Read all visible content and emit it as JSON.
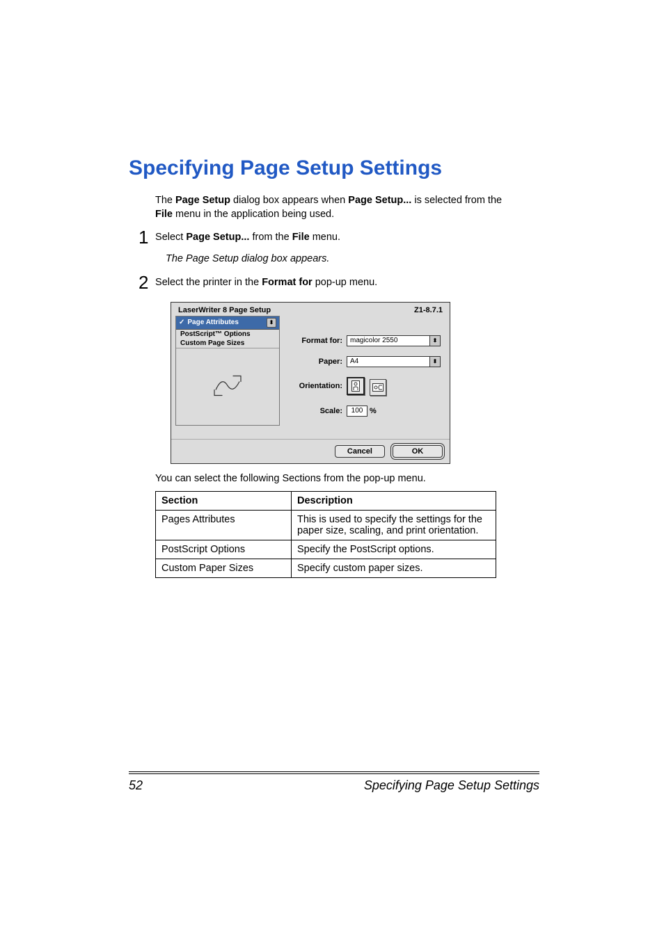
{
  "page": {
    "number": "52",
    "footer_title": "Specifying Page Setup Settings"
  },
  "heading": "Specifying Page Setup Settings",
  "intro": {
    "line1_pre": "The ",
    "line1_b1": "Page Setup",
    "line1_mid": " dialog box appears when ",
    "line1_b2": "Page Setup...",
    "line1_post": " is selected from the ",
    "line2_b": "File",
    "line2_post": " menu in the application being used."
  },
  "steps": {
    "s1": {
      "num": "1",
      "pre": "Select ",
      "b1": "Page Setup...",
      "mid": " from the ",
      "b2": "File",
      "post": " menu.",
      "italic": "The Page Setup dialog box appears."
    },
    "s2": {
      "num": "2",
      "pre": "Select the printer in the ",
      "b1": "Format for",
      "post": " pop-up menu."
    }
  },
  "dialog": {
    "title": "LaserWriter 8 Page Setup",
    "version": "Z1-8.7.1",
    "menu": {
      "selected": "Page Attributes",
      "opt2": "PostScript™ Options",
      "opt3": "Custom Page Sizes"
    },
    "fields": {
      "format_for_label": "Format for:",
      "format_for_value": "magicolor 2550",
      "paper_label": "Paper:",
      "paper_value": "A4",
      "orientation_label": "Orientation:",
      "scale_label": "Scale:",
      "scale_value": "100",
      "scale_unit": "%"
    },
    "buttons": {
      "cancel": "Cancel",
      "ok": "OK"
    }
  },
  "popup_note": "You can select the following Sections from the pop-up menu.",
  "table": {
    "h1": "Section",
    "h2": "Description",
    "rows": [
      {
        "section": "Pages Attributes",
        "desc": "This is used to specify the settings for the paper size, scaling, and print orientation."
      },
      {
        "section": "PostScript Options",
        "desc": "Specify the PostScript options."
      },
      {
        "section": "Custom Paper Sizes",
        "desc": "Specify custom paper sizes."
      }
    ]
  }
}
